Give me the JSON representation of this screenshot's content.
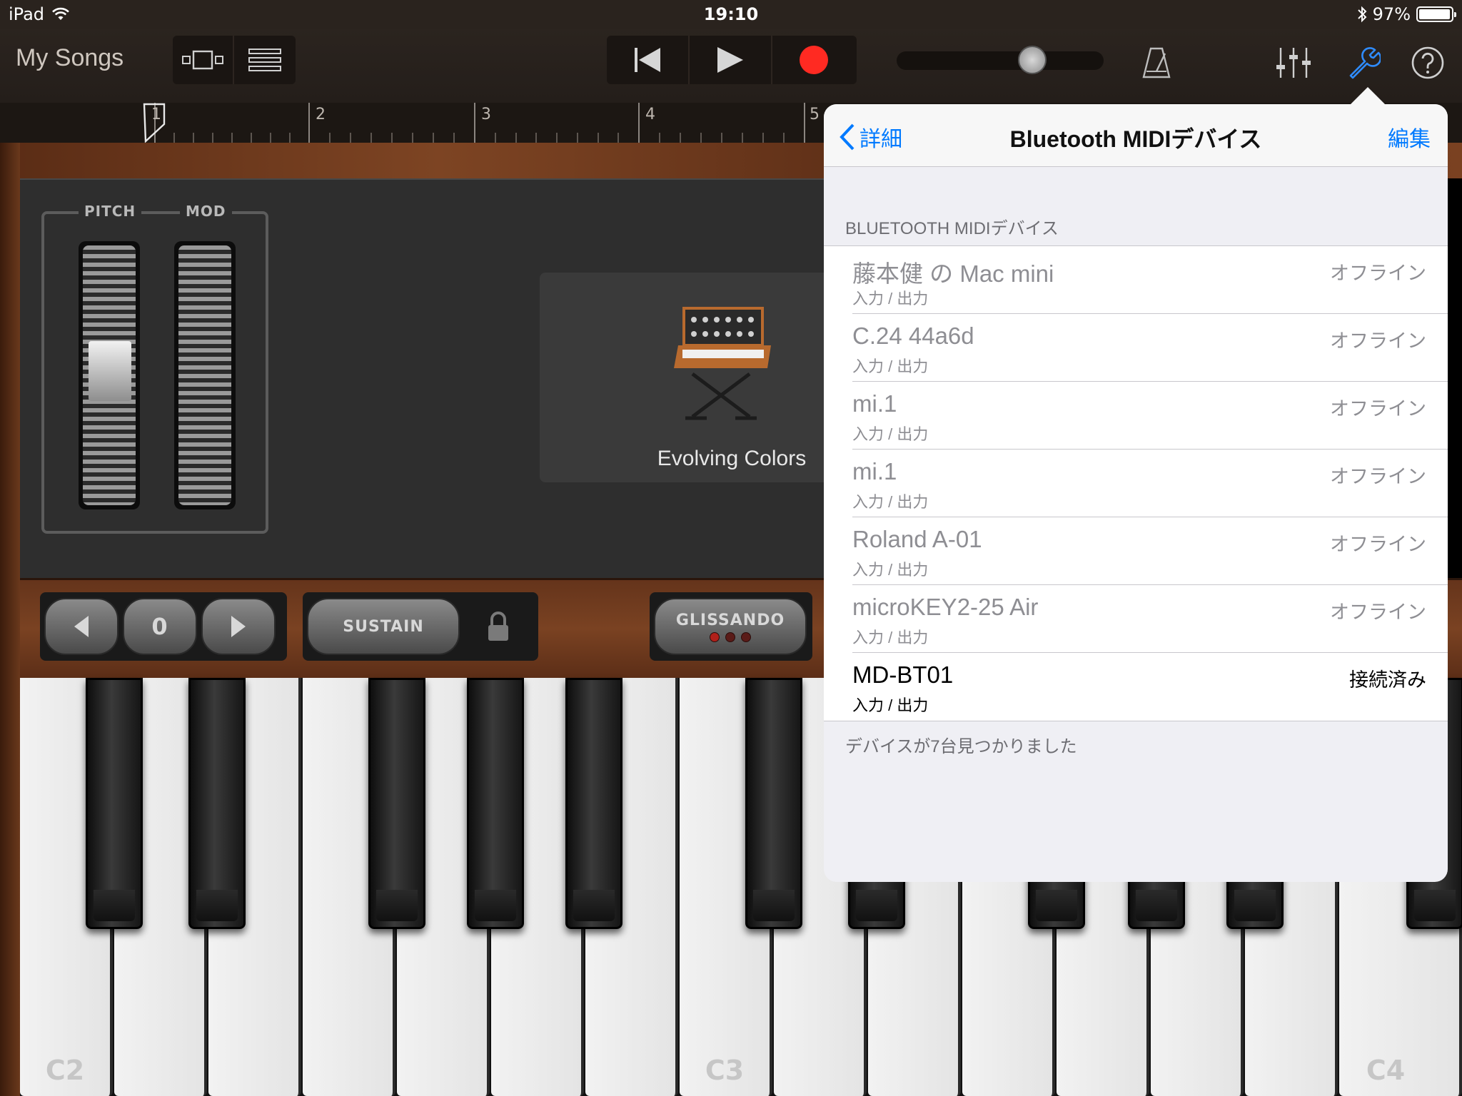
{
  "status_bar": {
    "device": "iPad",
    "time": "19:10",
    "battery": "97%",
    "battery_level": 0.97
  },
  "toolbar": {
    "my_songs": "My Songs",
    "tempo_level": 0.68
  },
  "ruler": {
    "bars": [
      "1",
      "2",
      "3",
      "4",
      "5"
    ]
  },
  "instrument": {
    "pitch_label": "PITCH",
    "mod_label": "MOD",
    "sound_name": "Evolving Colors",
    "octave_value": "0",
    "sustain_label": "SUSTAIN",
    "glissando_label": "GLISSANDO",
    "key_labels": {
      "c2": "C2",
      "c3": "C3",
      "c4": "C4"
    }
  },
  "popover": {
    "back_label": "詳細",
    "title": "Bluetooth MIDIデバイス",
    "edit_label": "編集",
    "section_header": "BLUETOOTH MIDIデバイス",
    "devices": [
      {
        "name": "藤本健 の Mac mini",
        "sub": "入力 / 出力",
        "status": "オフライン"
      },
      {
        "name": "C.24 44a6d",
        "sub": "入力 / 出力",
        "status": "オフライン"
      },
      {
        "name": "mi.1",
        "sub": "入力 / 出力",
        "status": "オフライン"
      },
      {
        "name": "mi.1",
        "sub": "入力 / 出力",
        "status": "オフライン"
      },
      {
        "name": "Roland A-01",
        "sub": "入力 / 出力",
        "status": "オフライン"
      },
      {
        "name": "microKEY2-25 Air",
        "sub": "入力 / 出力",
        "status": "オフライン"
      },
      {
        "name": "MD-BT01",
        "sub": "入力 / 出力",
        "status": "接続済み"
      }
    ],
    "footer": "デバイスが7台見つかりました"
  },
  "colors": {
    "accent": "#007aff",
    "record": "#ff2a22",
    "wood": "#7a4222"
  }
}
